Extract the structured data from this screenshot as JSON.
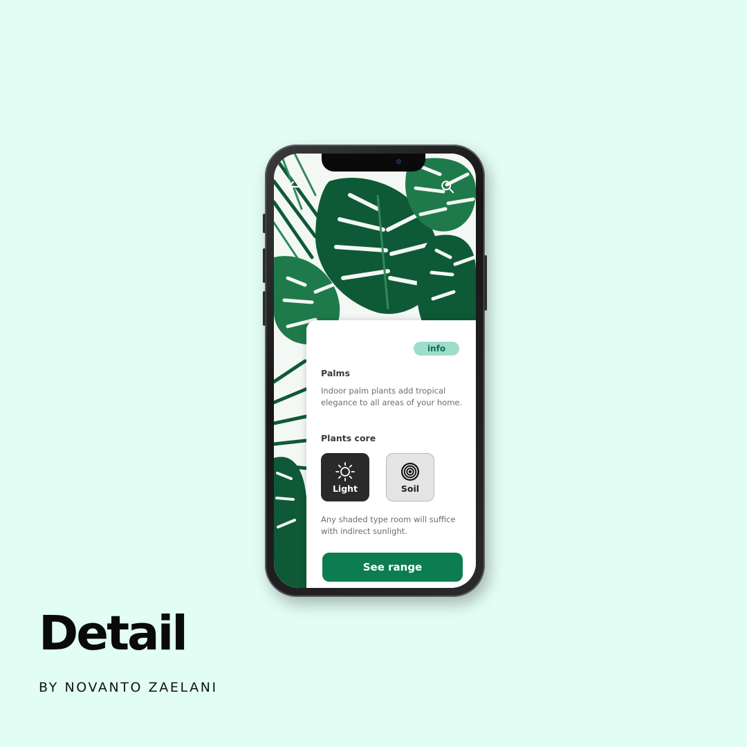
{
  "colors": {
    "background": "#e2fdf4",
    "accent_green": "#0b7d50",
    "badge_bg": "#9fdccb",
    "badge_text": "#0f6f50",
    "leaf_dark": "#0f5a36",
    "leaf_mid": "#1f7a4b"
  },
  "header": {
    "back_icon": "arrow-left-icon",
    "search_icon": "search-icon"
  },
  "card": {
    "badge": "info",
    "title": "Palms",
    "description": "Indoor palm plants add tropical elegance to all areas of your home.",
    "section_title": "Plants core",
    "care_options": [
      {
        "label": "Light",
        "icon": "sun-icon",
        "selected": true
      },
      {
        "label": "Soil",
        "icon": "soil-rings-icon",
        "selected": false
      }
    ],
    "care_text": "Any shaded type room will suffice with indirect sunlight.",
    "cta": "See range"
  },
  "caption": {
    "title": "Detail",
    "byline": "BY NOVANTO ZAELANI"
  }
}
